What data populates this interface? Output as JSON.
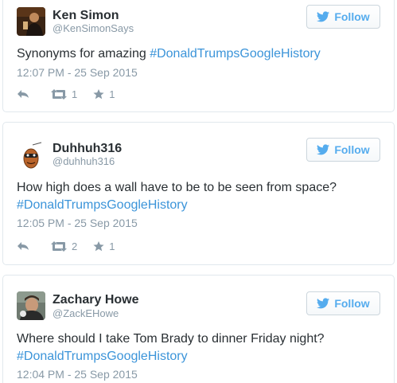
{
  "tweets": [
    {
      "name": "Ken Simon",
      "handle": "@KenSimonSays",
      "follow_label": "Follow",
      "text": "Synonyms for amazing ",
      "hashtag": "#DonaldTrumpsGoogleHistory",
      "timestamp": "12:07 PM - 25 Sep 2015",
      "retweets": "1",
      "favorites": "1"
    },
    {
      "name": "Duhhuh316",
      "handle": "@duhhuh316",
      "follow_label": "Follow",
      "text": "How high does a wall have to be to be seen from space?",
      "hashtag": "#DonaldTrumpsGoogleHistory",
      "timestamp": "12:05 PM - 25 Sep 2015",
      "retweets": "2",
      "favorites": "1"
    },
    {
      "name": "Zachary Howe",
      "handle": "@ZackEHowe",
      "follow_label": "Follow",
      "text": "Where should I take Tom Brady to dinner Friday night?",
      "hashtag": "#DonaldTrumpsGoogleHistory",
      "timestamp": "12:04 PM - 25 Sep 2015"
    }
  ],
  "colors": {
    "link": "#3b94d9",
    "twitter_blue": "#55acee",
    "muted": "#8899a6",
    "text": "#292f33",
    "border": "#e1e8ed"
  },
  "icons": [
    "twitter-bird-icon",
    "reply-icon",
    "retweet-icon",
    "favorite-star-icon"
  ]
}
